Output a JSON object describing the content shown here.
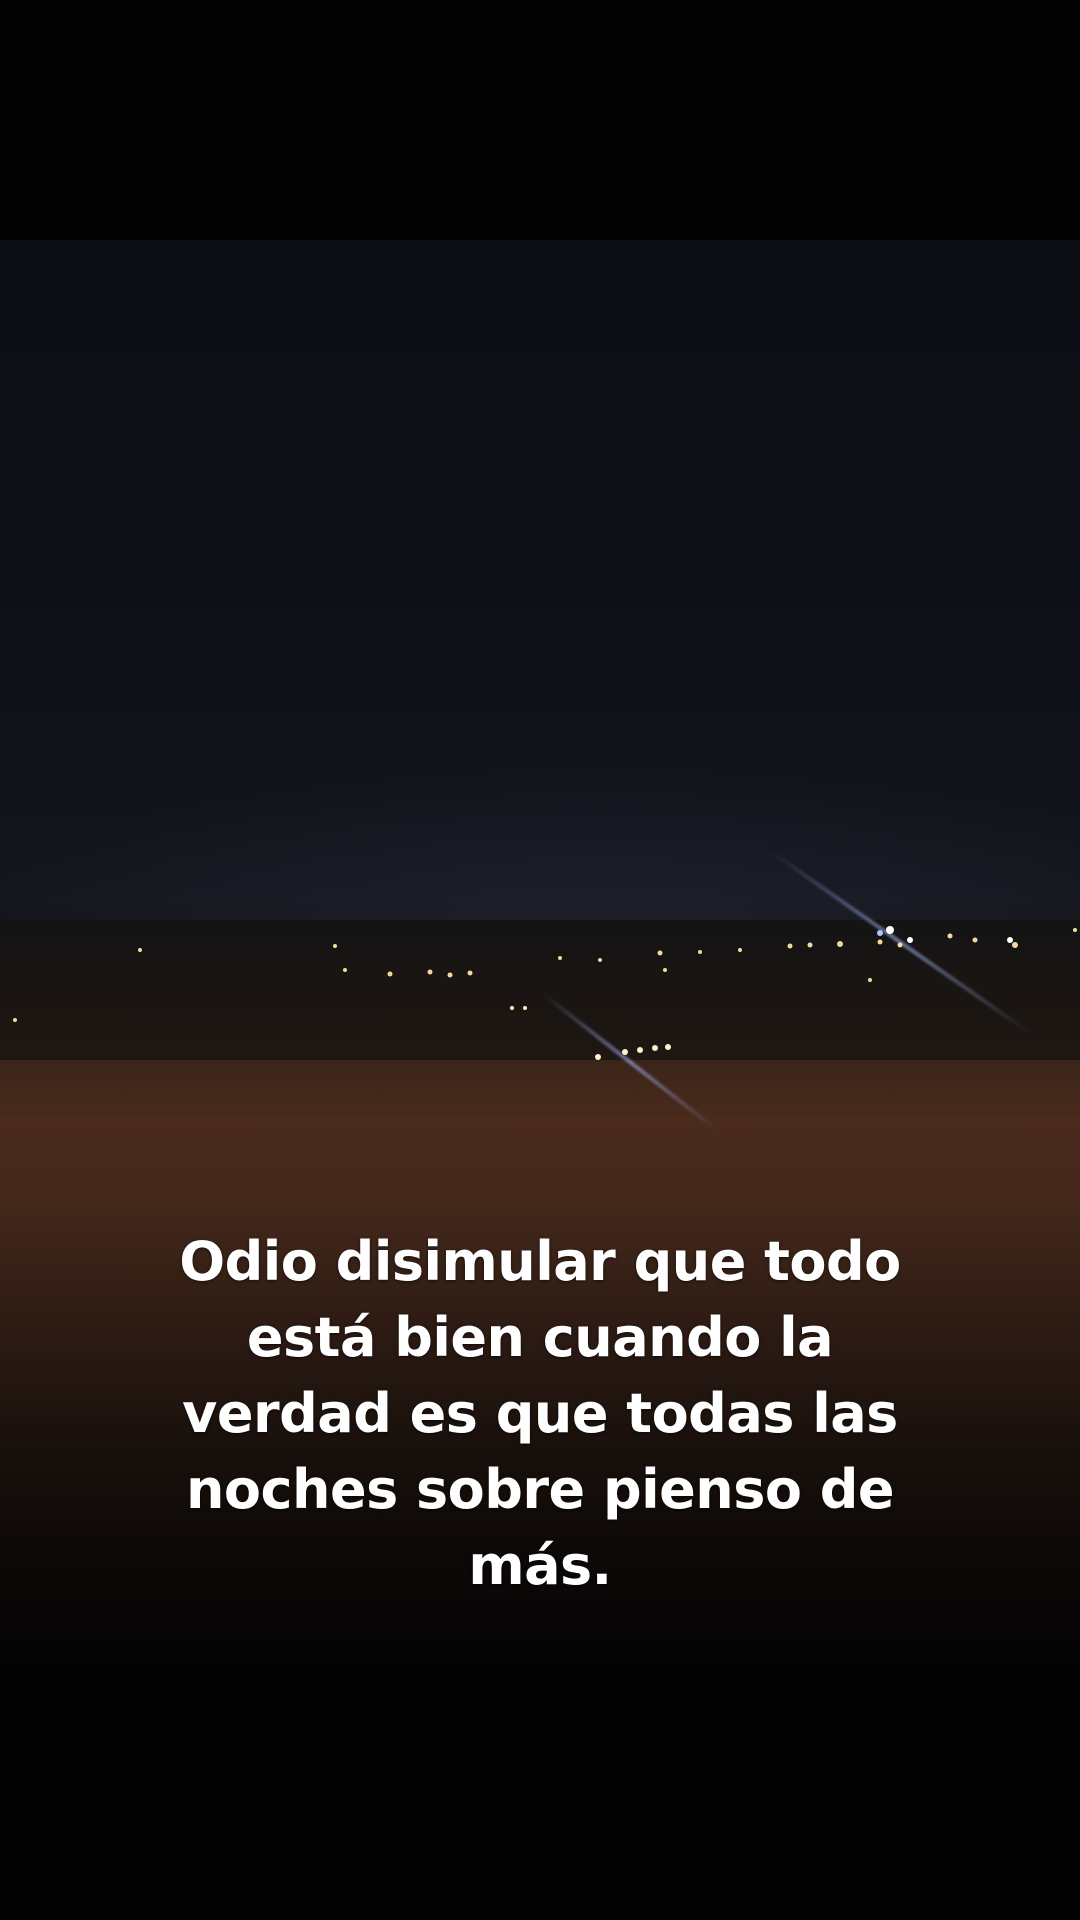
{
  "caption": {
    "text": "Odio disimular que todo está bien cuando la verdad es que todas las noches sobre pienso de más."
  },
  "photo": {
    "scene": "night-cityscape"
  },
  "colors": {
    "background": "#030304",
    "sky": "#0e0f16",
    "ground": "#4a2b1c",
    "caption_text": "#ffffff"
  }
}
